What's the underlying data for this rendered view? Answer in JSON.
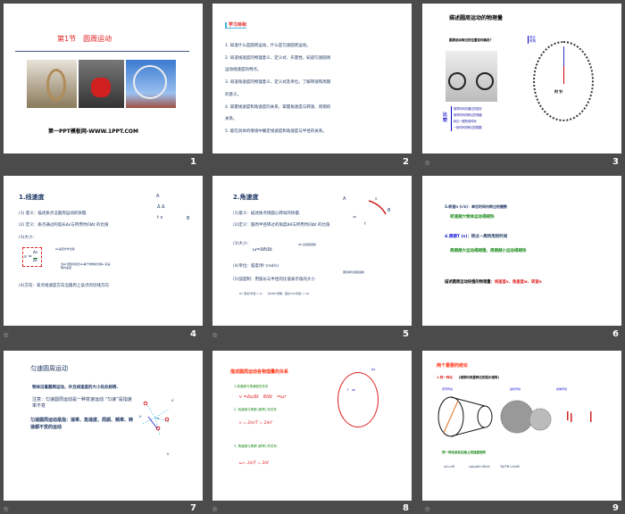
{
  "transition_icon": "☆",
  "slides": [
    {
      "num": "1",
      "title": "第1节　圆周运动",
      "footer": "第一PPT模板网-WWW.1PPT.COM"
    },
    {
      "num": "2",
      "heading": "学习目标",
      "items": [
        "1. 知道什么是圆周运动，什么是匀速圆周运动。",
        "2. 知道线速度的物理意义、定义式、矢量性，知道匀速圆周",
        "运动线速度的特点。",
        "3. 知道角速度的物理意义、定义式及单位，了解转速和周期",
        "的意义。",
        "4. 掌握线速度和角速度的关系，掌握角速度与转速、周期的",
        "关系。",
        "5. 能在具体的情境中确定线速度和角速度与半径的关系。"
      ]
    },
    {
      "num": "3",
      "title": "描述圆周运动的物理量",
      "question": "圆周运动转过的位置如何确定?",
      "brace_right": [
        "弧长",
        "转角"
      ],
      "compare_label": "比较",
      "compare": [
        "相同时间内通过的弧长",
        "相同时间内转过的角度",
        "转过一圈所用时间",
        "一段时间内转过的圈数"
      ],
      "clock_label": "时 针"
    },
    {
      "num": "4",
      "title": "1.线速度",
      "l1": "(1) 意义：描述质点沿圆周运动的快慢.",
      "l2": "(2) 定义：质点通过的弧长Δs与所用时间Δt 的比值",
      "l3": "(3)大小：",
      "formula_v": "v =",
      "formula_num": "Δs",
      "formula_den": "Δt",
      "note1": "Δs是弧长非位移",
      "note2": "当Δt 很短时弧长Δs等于物体的位移v 就是瞬时速度",
      "l4": "(4)方向：某点线速度方向沿圆周上该点的切线方向",
      "diagram": [
        "A",
        "Δ Δ",
        "t  s",
        "B"
      ]
    },
    {
      "num": "5",
      "title": "2.角速度",
      "l1": "(1)意义：描述质点绕圆心转动的快慢.",
      "l2": "(2)定义：圆周半径转过的角度Δθ与所用时间Δt 的比值",
      "l3": "(3)大小：",
      "formula": "ω=Δθ/Δt",
      "note": "Δθ 采用弧度制",
      "l4": "(4)单位：弧度/秒 (rad/s)",
      "note2": "国际单位用弧度制",
      "l5": "(5)弧度制：用弧长与半径的比值表示角的大小",
      "eq": "θ= 弧长/半径 = l/r　　对360°周角：弧长2πr/半径r = 2π",
      "diagram": [
        "A",
        "s",
        "B",
        "Δθ",
        "r"
      ]
    },
    {
      "num": "6",
      "l1": "3.转速n (r/s)：单位时间内转过的圈数",
      "l2": "转速越大物体运动得越快",
      "l3_a": "4.周期T (s)",
      "l3_b": "：转过一周所用的时间",
      "l4": "周期越大运动得越慢，周期越小运动得越快",
      "l5_a": "描述圆周运动快慢的物理量：",
      "l5_b": "线速度v、角速度w、转速n"
    },
    {
      "num": "7",
      "title": "匀速圆周运动",
      "p1": "物体沿着圆周运动，并且线速度的大小处处相等.",
      "p2": "注意：匀速圆周运动是一种变速运动.“匀速”是指速率不变",
      "p3": "匀速圆周运动是指：速率、角速度、周期、频率、转速都不变的运动",
      "labels": [
        "v",
        "v",
        "v",
        "o"
      ]
    },
    {
      "num": "8",
      "title": "描述圆周运动各物理量的关系",
      "s1": "1.线速度与角速度的关系",
      "f1": "v =Δs/Δt　θ/Δt　=ωr",
      "s2": "2. 线速度与周期 (频率) 的关系",
      "f2": "v = 2πr/T = 2πrf",
      "s3": "3. 角速度与周期 (频率) 的关系:",
      "f3": "ω= 2π/T = 2πf",
      "circle_labels": [
        "Δs",
        "r",
        "Δθ"
      ]
    },
    {
      "num": "9",
      "title": "两个重要的结论",
      "l1_a": "1.同一传动",
      "l1_b": "(相等时间里转过的弧长相等)",
      "types": [
        "皮带传动",
        "齿轮传动",
        "摩擦传动"
      ],
      "l2": "同一传动各轮边缘上线速度相同",
      "eqs": [
        "vA=vB",
        "ωA/ωB=rB/rA",
        "TA/TB=rA/rB"
      ]
    }
  ]
}
